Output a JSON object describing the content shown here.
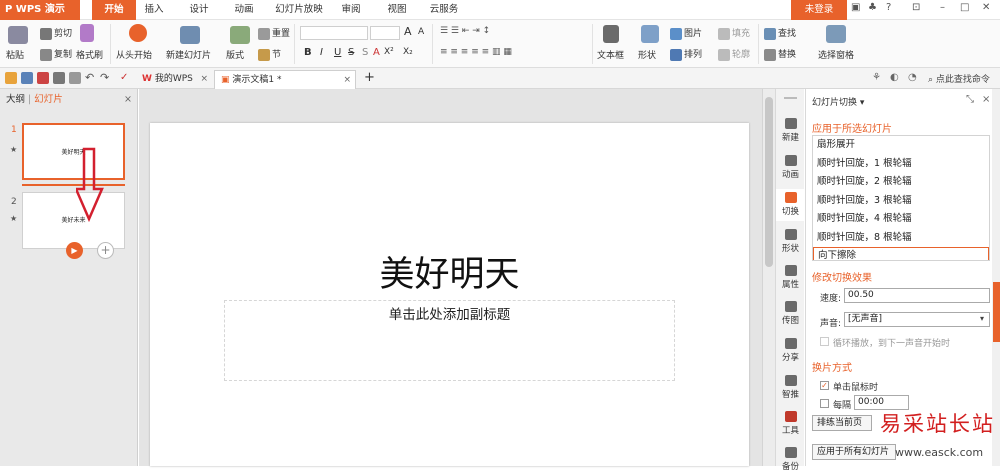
{
  "app": {
    "logo": "P WPS 演示",
    "login": "未登录"
  },
  "menu_tabs": [
    "开始",
    "插入",
    "设计",
    "动画",
    "幻灯片放映",
    "审阅",
    "视图",
    "云服务"
  ],
  "ribbon": {
    "paste": "粘贴",
    "cut": "剪切",
    "copy": "复制",
    "format_painter": "格式刷",
    "from_start": "从头开始",
    "new_slide": "新建幻灯片",
    "layout": "版式",
    "reset": "重置",
    "section": "节",
    "text_box": "文本框",
    "shape": "形状",
    "arrange": "排列",
    "picture": "图片",
    "fill": "填充",
    "outline": "轮廓",
    "find": "查找",
    "replace": "替换",
    "select_pane": "选择窗格",
    "bold": "B",
    "italic": "I",
    "underline": "U",
    "strike": "S",
    "shadow": "S",
    "font_color": "A",
    "superscript": "X²",
    "subscript": "X₂",
    "font_grow": "A",
    "font_shrink": "A"
  },
  "quick_bar": {
    "tabs": [
      {
        "label": "我的WPS"
      },
      {
        "label": "演示文稿1 *"
      }
    ],
    "add": "+",
    "search": "点此查找命令"
  },
  "left_panel": {
    "tab_outline": "大纲",
    "tab_slides": "幻灯片",
    "slides": [
      {
        "num": "1",
        "text": "美好明天"
      },
      {
        "num": "2",
        "text": "美好未来"
      }
    ]
  },
  "slide": {
    "title": "美好明天",
    "subtitle": "单击此处添加副标题"
  },
  "icon_bar": [
    {
      "label": "新建",
      "icon": "new-icon"
    },
    {
      "label": "动画",
      "icon": "animation-icon"
    },
    {
      "label": "切换",
      "icon": "transition-icon"
    },
    {
      "label": "形状",
      "icon": "shape-icon"
    },
    {
      "label": "属性",
      "icon": "property-icon"
    },
    {
      "label": "传图",
      "icon": "upload-image-icon"
    },
    {
      "label": "分享",
      "icon": "share-icon"
    },
    {
      "label": "智推",
      "icon": "recommend-icon"
    },
    {
      "label": "工具",
      "icon": "tools-icon"
    },
    {
      "label": "备份",
      "icon": "backup-icon"
    }
  ],
  "right_panel": {
    "title": "幻灯片切换 ▾",
    "apply_section": "应用于所选幻灯片",
    "transitions": [
      "扇形展开",
      "顺时针回旋，1 根轮辐",
      "顺时针回旋，2 根轮辐",
      "顺时针回旋，3 根轮辐",
      "顺时针回旋，4 根轮辐",
      "顺时针回旋，8 根轮辐",
      "向下擦除"
    ],
    "modify_section": "修改切换效果",
    "speed_label": "速度:",
    "speed_value": "00.50",
    "sound_label": "声音:",
    "sound_value": "[无声音]",
    "loop_label": "循环播放，到下一声音开始时",
    "switch_section": "换片方式",
    "on_click": "单击鼠标时",
    "every": "每隔",
    "every_value": "00:00",
    "rehearse": "排练当前页",
    "apply_all": "应用于所有幻灯片"
  },
  "watermark": {
    "text": "易采站长站",
    "url": "www.easck.com"
  },
  "colors": {
    "accent": "#e8622b",
    "arrow": "#d3202f"
  }
}
